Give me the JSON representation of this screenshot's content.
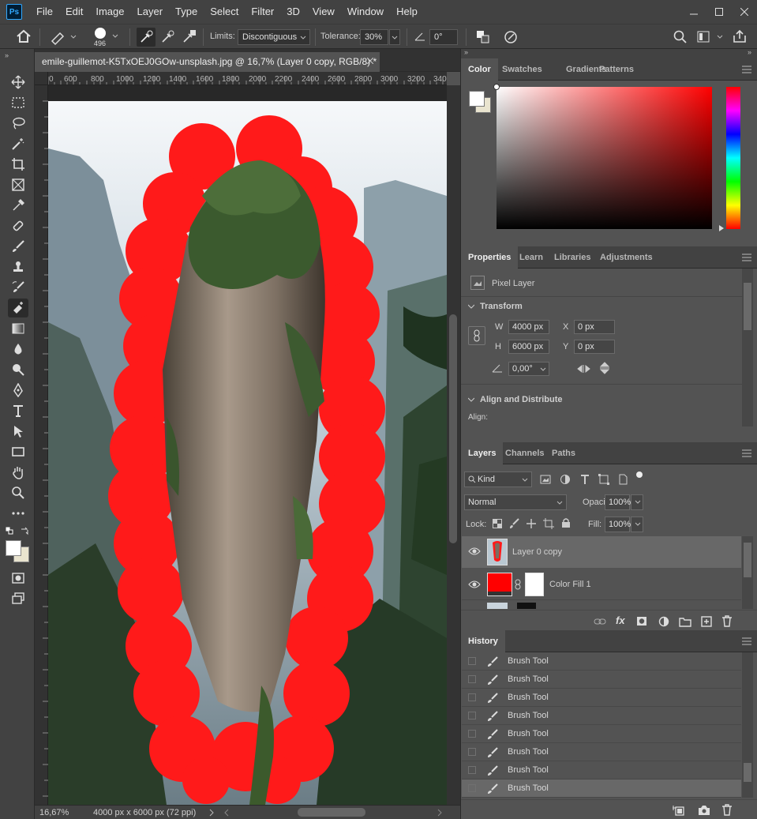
{
  "app": {
    "logo": "Ps"
  },
  "menubar": {
    "items": [
      "File",
      "Edit",
      "Image",
      "Layer",
      "Type",
      "Select",
      "Filter",
      "3D",
      "View",
      "Window",
      "Help"
    ]
  },
  "options": {
    "brush_size": "496",
    "limits_label": "Limits:",
    "limits_value": "Discontiguous",
    "tolerance_label": "Tolerance:",
    "tolerance_value": "30%",
    "angle_value": "0°"
  },
  "document": {
    "tab_title": "emile-guillemot-K5TxOEJ0GOw-unsplash.jpg @ 16,7% (Layer 0 copy, RGB/8) *",
    "ruler_ticks": [
      "0",
      "600",
      "800",
      "1000",
      "1200",
      "1400",
      "1600",
      "1800",
      "2000",
      "2200",
      "2400",
      "2600",
      "2800",
      "3000",
      "3200",
      "340"
    ],
    "zoom": "16,67%",
    "doc_info": "4000 px x 6000 px (72 ppi)"
  },
  "color_panel": {
    "tabs": [
      "Color",
      "Swatches",
      "Gradients",
      "Patterns"
    ],
    "foreground": "#ffffff",
    "background": "#e9e4cf",
    "hue_color": "#ff0000"
  },
  "properties_panel": {
    "tabs": [
      "Properties",
      "Learn",
      "Libraries",
      "Adjustments"
    ],
    "layer_type": "Pixel Layer",
    "transform_title": "Transform",
    "w_label": "W",
    "w_value": "4000 px",
    "h_label": "H",
    "h_value": "6000 px",
    "x_label": "X",
    "x_value": "0 px",
    "y_label": "Y",
    "y_value": "0 px",
    "angle_value": "0,00°",
    "align_title": "Align and Distribute",
    "align_label": "Align:"
  },
  "layers_panel": {
    "tabs": [
      "Layers",
      "Channels",
      "Paths"
    ],
    "filter_kind": "Kind",
    "blend_mode": "Normal",
    "opacity_label": "Opacity:",
    "opacity_value": "100%",
    "lock_label": "Lock:",
    "fill_label": "Fill:",
    "fill_value": "100%",
    "layers": [
      {
        "name": "Layer 0 copy",
        "selected": true
      },
      {
        "name": "Color Fill 1",
        "selected": false
      }
    ],
    "fill_color": "#ff0000"
  },
  "history_panel": {
    "tab": "History",
    "items": [
      "Brush Tool",
      "Brush Tool",
      "Brush Tool",
      "Brush Tool",
      "Brush Tool",
      "Brush Tool",
      "Brush Tool",
      "Brush Tool"
    ]
  }
}
